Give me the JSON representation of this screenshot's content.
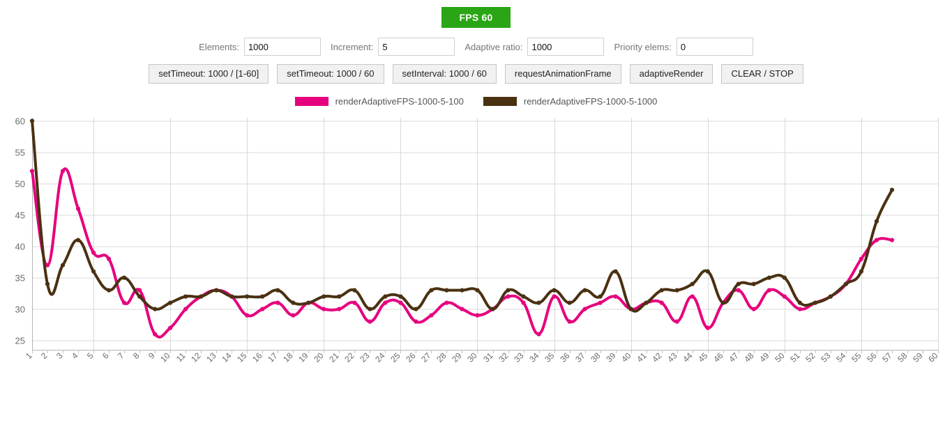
{
  "status": {
    "fps_label": "FPS 60",
    "fps_color": "#2aa515"
  },
  "controls": {
    "fields": [
      {
        "label": "Elements:",
        "value": "1000",
        "name": "elements"
      },
      {
        "label": "Increment:",
        "value": "5",
        "name": "increment"
      },
      {
        "label": "Adaptive ratio:",
        "value": "1000",
        "name": "adaptive-ratio"
      },
      {
        "label": "Priority elems:",
        "value": "0",
        "name": "priority-elems"
      }
    ],
    "buttons": [
      "setTimeout: 1000 / [1-60]",
      "setTimeout: 1000 / 60",
      "setInterval: 1000 / 60",
      "requestAnimationFrame",
      "adaptiveRender",
      "CLEAR / STOP"
    ]
  },
  "chart_data": {
    "type": "line",
    "title": "",
    "xlabel": "",
    "ylabel": "",
    "grid": true,
    "legend_position": "top-center",
    "x": [
      1,
      2,
      3,
      4,
      5,
      6,
      7,
      8,
      9,
      10,
      11,
      12,
      13,
      14,
      15,
      16,
      17,
      18,
      19,
      20,
      21,
      22,
      23,
      24,
      25,
      26,
      27,
      28,
      29,
      30,
      31,
      32,
      33,
      34,
      35,
      36,
      37,
      38,
      39,
      40,
      41,
      42,
      43,
      44,
      45,
      46,
      47,
      48,
      49,
      50,
      51,
      52,
      53,
      54,
      55,
      56,
      57,
      58,
      59,
      60
    ],
    "xtick_labels": [
      "1",
      "2",
      "3",
      "4",
      "5",
      "6",
      "7",
      "8",
      "9",
      "10",
      "11",
      "12",
      "13",
      "14",
      "15",
      "16",
      "17",
      "18",
      "19",
      "20",
      "21",
      "22",
      "23",
      "24",
      "25",
      "26",
      "27",
      "28",
      "29",
      "30",
      "31",
      "32",
      "33",
      "34",
      "35",
      "36",
      "37",
      "38",
      "39",
      "40",
      "41",
      "42",
      "43",
      "44",
      "45",
      "46",
      "47",
      "48",
      "49",
      "50",
      "51",
      "52",
      "53",
      "54",
      "55",
      "56",
      "57",
      "58",
      "59",
      "60"
    ],
    "ytick_labels": [
      "25",
      "30",
      "35",
      "40",
      "45",
      "50",
      "55",
      "60"
    ],
    "yticks": [
      25,
      30,
      35,
      40,
      45,
      50,
      55,
      60
    ],
    "ylim": [
      23.5,
      60.5
    ],
    "xlim": [
      1,
      60
    ],
    "series": [
      {
        "name": "renderAdaptiveFPS-1000-5-100",
        "color": "#e6007e",
        "values": [
          52,
          37,
          52,
          46,
          39,
          38,
          31,
          33,
          26,
          27,
          30,
          32,
          33,
          32,
          29,
          30,
          31,
          29,
          31,
          30,
          30,
          31,
          28,
          31,
          31,
          28,
          29,
          31,
          30,
          29,
          30,
          32,
          31,
          26,
          32,
          28,
          30,
          31,
          32,
          30,
          31,
          31,
          28,
          32,
          27,
          31,
          33,
          30,
          33,
          32,
          30,
          31,
          32,
          34,
          38,
          41,
          41,
          null,
          null,
          null
        ]
      },
      {
        "name": "renderAdaptiveFPS-1000-5-1000",
        "color": "#4a3112",
        "values": [
          60,
          34,
          37,
          41,
          36,
          33,
          35,
          32,
          30,
          31,
          32,
          32,
          33,
          32,
          32,
          32,
          33,
          31,
          31,
          32,
          32,
          33,
          30,
          32,
          32,
          30,
          33,
          33,
          33,
          33,
          30,
          33,
          32,
          31,
          33,
          31,
          33,
          32,
          36,
          30,
          31,
          33,
          33,
          34,
          36,
          31,
          34,
          34,
          35,
          35,
          31,
          31,
          32,
          34,
          36,
          44,
          49,
          null,
          null,
          null
        ]
      }
    ]
  }
}
